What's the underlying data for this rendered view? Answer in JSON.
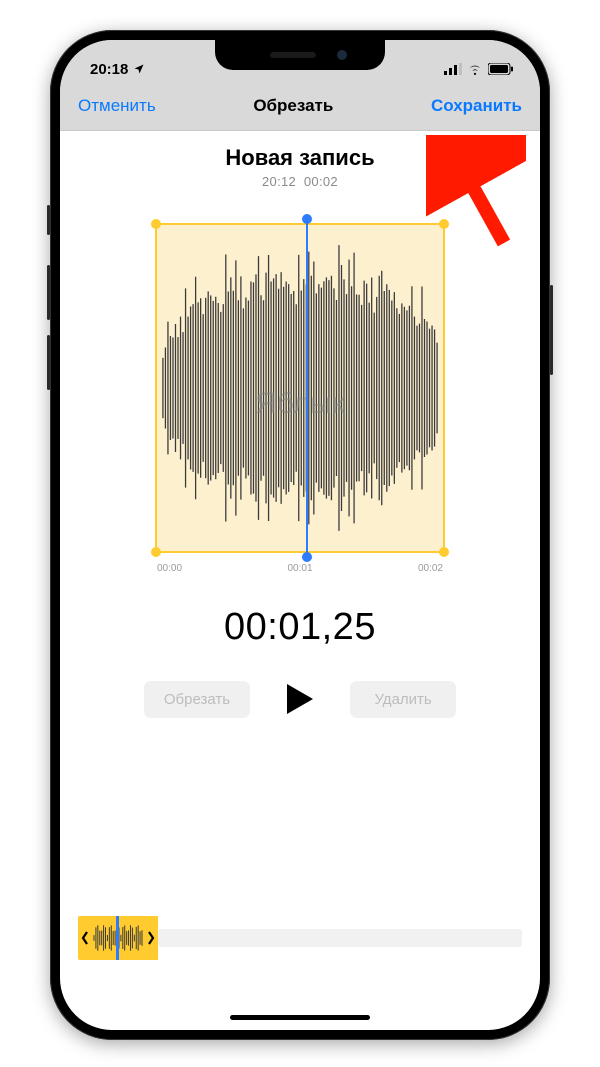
{
  "status_bar": {
    "time": "20:18",
    "has_location_icon": true,
    "signal_icon": "cellular-signal-icon",
    "wifi_icon": "wifi-icon",
    "battery_icon": "battery-icon"
  },
  "nav": {
    "cancel": "Отменить",
    "title": "Обрезать",
    "save": "Сохранить"
  },
  "recording": {
    "title": "Новая запись",
    "created_time": "20:12",
    "duration": "00:02",
    "watermark": "Яблык"
  },
  "time_axis": {
    "t0": "00:00",
    "t1": "00:01",
    "t2": "00:02"
  },
  "playback": {
    "current_time": "00:01,25"
  },
  "controls": {
    "trim": "Обрезать",
    "delete": "Удалить"
  },
  "annotation": {
    "points_to": "save-button"
  },
  "colors": {
    "accent_blue": "#097aff",
    "trim_yellow": "#ffcb2e",
    "playhead_blue": "#2d7bff"
  }
}
